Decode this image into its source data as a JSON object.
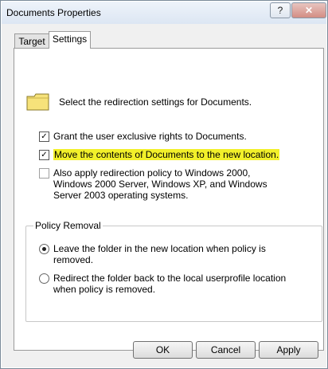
{
  "window": {
    "title": "Documents Properties",
    "help_label": "?",
    "close_label": "✕"
  },
  "tabs": [
    {
      "label": "Target"
    },
    {
      "label": "Settings"
    }
  ],
  "settings": {
    "info_text": "Select the redirection settings for Documents.",
    "options": [
      {
        "label": "Grant the user exclusive rights to Documents.",
        "checked": true
      },
      {
        "label": "Move the contents of Documents to the new location.",
        "checked": true
      },
      {
        "label": "Also apply redirection policy to Windows 2000, Windows 2000 Server, Windows XP, and Windows Server 2003 operating systems.",
        "checked": false
      }
    ],
    "policy_removal": {
      "title": "Policy Removal",
      "options": [
        {
          "label": "Leave the folder in the new location when policy is removed.",
          "selected": true
        },
        {
          "label": "Redirect the folder back to the local userprofile location when policy is removed.",
          "selected": false
        }
      ]
    }
  },
  "buttons": {
    "ok": "OK",
    "cancel": "Cancel",
    "apply": "Apply"
  },
  "colors": {
    "highlight": "#f2f02a",
    "folder": "#f6e27a"
  }
}
